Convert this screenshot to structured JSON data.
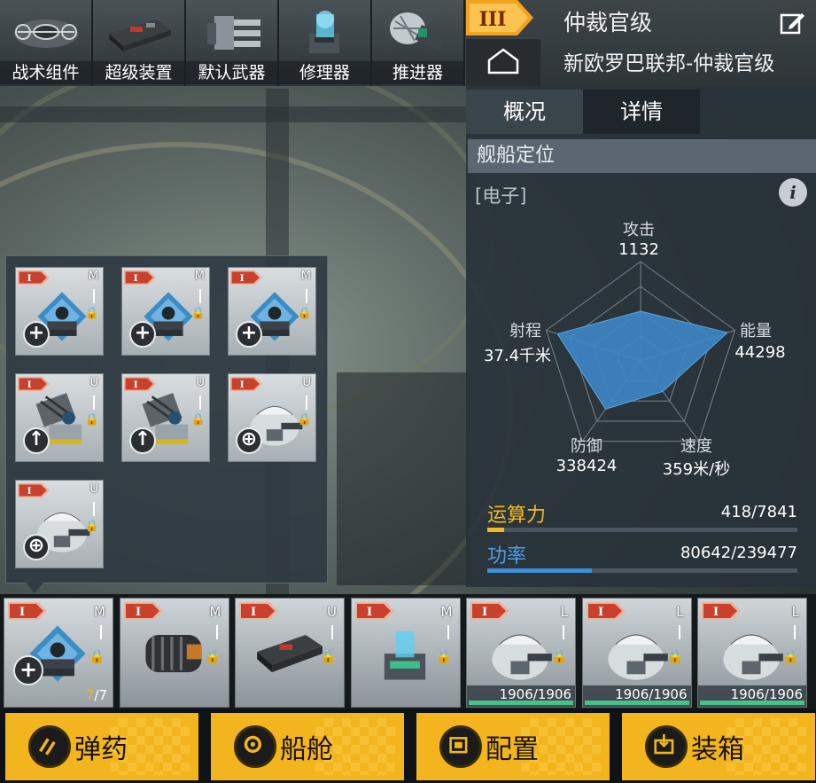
{
  "top_tabs": [
    {
      "label": "战术组件",
      "icon": "tactical-module-icon"
    },
    {
      "label": "超级装置",
      "icon": "super-device-icon"
    },
    {
      "label": "默认武器",
      "icon": "default-weapon-icon"
    },
    {
      "label": "修理器",
      "icon": "repair-unit-icon"
    },
    {
      "label": "推进器",
      "icon": "thruster-icon"
    }
  ],
  "ship": {
    "tier": "III",
    "title": "仲裁官级",
    "subtitle": "新欧罗巴联邦-仲裁官级"
  },
  "panel": {
    "tabs": [
      "概况",
      "详情"
    ],
    "active_tab": "概况",
    "section_title": "舰船定位",
    "role": "[电子]",
    "info_icon": "i"
  },
  "stats": {
    "attack": {
      "label": "攻击",
      "value": "1132",
      "level": 0.5
    },
    "energy": {
      "label": "能量",
      "value": "44298",
      "level": 0.92
    },
    "speed": {
      "label": "速度",
      "value": "359米/秒",
      "level": 0.38
    },
    "defense": {
      "label": "防御",
      "value": "338424",
      "level": 0.6
    },
    "range": {
      "label": "射程",
      "value": "37.4千米",
      "level": 0.88
    }
  },
  "bars": {
    "compute": {
      "label": "运算力",
      "value": "418/7841",
      "fraction": 0.053,
      "color": "#f5b722"
    },
    "power": {
      "label": "功率",
      "value": "80642/239477",
      "fraction": 0.337,
      "color": "#3f8ed8"
    }
  },
  "popup_slots": [
    {
      "tier": "M",
      "action": "add",
      "type": "tactical-module"
    },
    {
      "tier": "M",
      "action": "add",
      "type": "tactical-module"
    },
    {
      "tier": "M",
      "action": "add",
      "type": "tactical-module"
    },
    {
      "tier": "U",
      "action": "upgrade",
      "type": "launcher"
    },
    {
      "tier": "U",
      "action": "upgrade",
      "type": "launcher"
    },
    {
      "tier": "U",
      "action": "target",
      "type": "turret"
    },
    {
      "tier": "U",
      "action": "target",
      "type": "turret"
    }
  ],
  "bottom_slots": [
    {
      "tier": "M",
      "type": "tactical-module",
      "count_current": "7",
      "count_total": "/7"
    },
    {
      "tier": "M",
      "type": "engine"
    },
    {
      "tier": "U",
      "type": "super-device"
    },
    {
      "tier": "M",
      "type": "repair-unit"
    },
    {
      "tier": "L",
      "type": "turret",
      "durability": "1906/1906"
    },
    {
      "tier": "L",
      "type": "turret",
      "durability": "1906/1906"
    },
    {
      "tier": "L",
      "type": "turret",
      "durability": "1906/1906"
    }
  ],
  "actions": [
    {
      "label": "弹药",
      "icon": "ammo-icon"
    },
    {
      "label": "船舱",
      "icon": "cabin-icon"
    },
    {
      "label": "配置",
      "icon": "config-icon"
    },
    {
      "label": "装箱",
      "icon": "crate-icon"
    }
  ],
  "colors": {
    "accent": "#f2b51e",
    "radar_fill": "#3d86c6",
    "badge": "#e8b49a"
  }
}
